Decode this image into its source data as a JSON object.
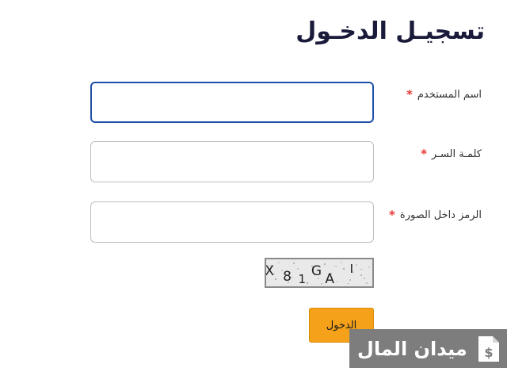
{
  "form": {
    "title": "تسجيـل الدخـول",
    "username_label": "اسم المستخدم",
    "password_label": "كلمـة السـر",
    "captcha_label": "الرمز داخل الصورة",
    "required_mark": "*",
    "submit_label": "الدخول"
  },
  "captcha": {
    "chars": [
      "X",
      "8",
      "1",
      "G",
      "A",
      "I"
    ]
  },
  "watermark": {
    "text": "ميدان المال"
  }
}
